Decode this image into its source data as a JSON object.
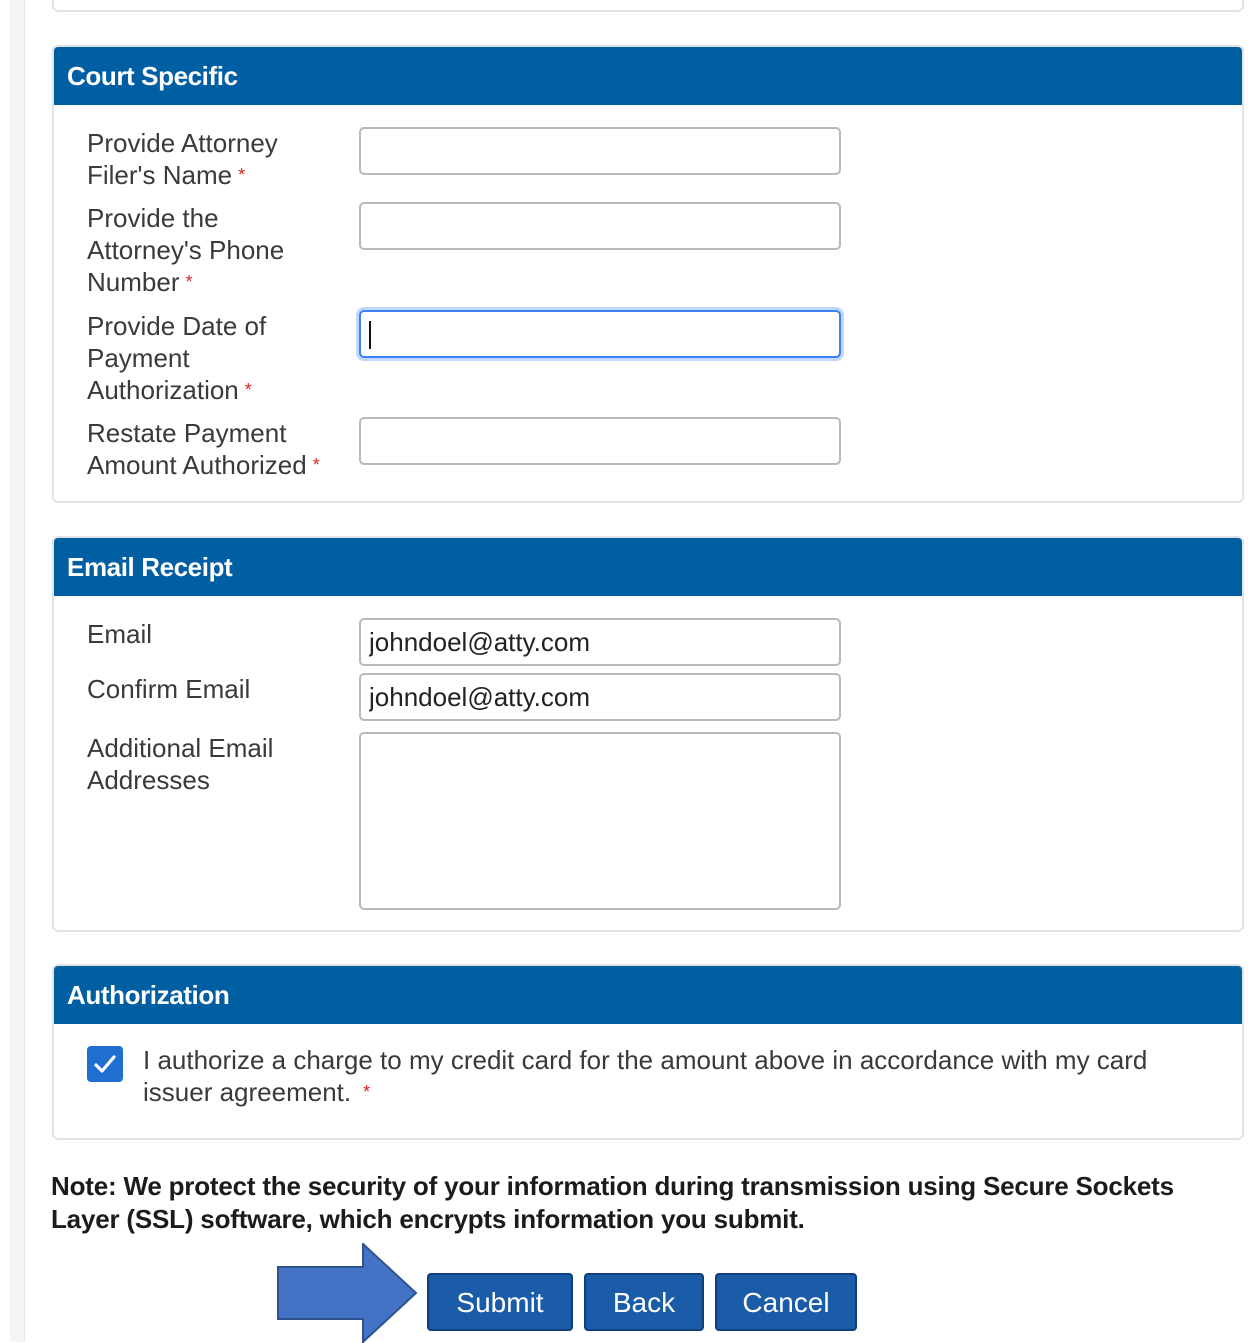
{
  "court_specific": {
    "title": "Court Specific",
    "fields": [
      {
        "label": "Provide Attorney Filer's Name",
        "required_mark": "*",
        "value": ""
      },
      {
        "label": "Provide the Attorney's Phone Number",
        "required_mark": "*",
        "value": ""
      },
      {
        "label": "Provide Date of Payment Authorization",
        "required_mark": "*",
        "value": ""
      },
      {
        "label": "Restate Payment Amount Authorized",
        "required_mark": "*",
        "value": ""
      }
    ]
  },
  "email_receipt": {
    "title": "Email Receipt",
    "email_label": "Email",
    "email_value": "johndoel@atty.com",
    "confirm_label": "Confirm Email",
    "confirm_value": "johndoel@atty.com",
    "additional_label": "Additional Email Addresses",
    "additional_value": ""
  },
  "authorization": {
    "title": "Authorization",
    "checked": true,
    "text": "I authorize a charge to my credit card for the amount above in accordance with my card issuer agreement.",
    "required_mark": "*"
  },
  "note": "Note: We protect the security of your information during transmission using Secure Sockets Layer (SSL) software, which encrypts information you submit.",
  "buttons": {
    "submit": "Submit",
    "back": "Back",
    "cancel": "Cancel"
  },
  "colors": {
    "header_blue": "#005ea2",
    "button_blue": "#1a5ca8",
    "arrow_blue": "#4472c4",
    "required_red": "#e02020"
  }
}
